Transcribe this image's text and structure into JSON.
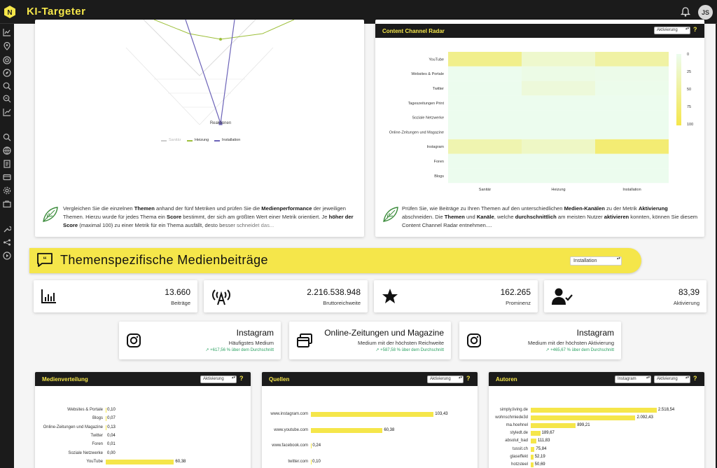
{
  "app": {
    "title": "KI-Targeter",
    "user_initials": "JS",
    "accent": "#f5e64a",
    "dark": "#1b1b1b"
  },
  "radar": {
    "axis_label": "Reaktionen",
    "legend": [
      "Sanitär",
      "Heizung",
      "Installation"
    ],
    "text_html": "Vergleichen Sie die einzelnen <b>Themen</b> anhand der fünf Metriken und prüfen Sie die <b>Medienperformance</b> der jeweiligen Themen. Hierzu wurde für jedes Thema ein <b>Score</b> bestimmt, der sich am größten Wert einer Metrik orientiert. Je <b>höher der Score</b> (maximal 100) zu einer Metrik für ein Thema ausfällt, desto besser schneidet das..."
  },
  "heatmap": {
    "title": "Content Channel Radar",
    "select": "Aktivierung",
    "help": "?",
    "rows": [
      "YouTube",
      "Websites & Portale",
      "Twitter",
      "Tageszeitungen Print",
      "Soziale Netzwerke",
      "Online-Zeitungen und Magazine",
      "Instagram",
      "Foren",
      "Blogs"
    ],
    "cols": [
      "Sanitär",
      "Heizung",
      "Installation"
    ],
    "values": [
      [
        60,
        20,
        45
      ],
      [
        0,
        5,
        3
      ],
      [
        0,
        12,
        2
      ],
      [
        0,
        0,
        0
      ],
      [
        0,
        0,
        0
      ],
      [
        0,
        0,
        0
      ],
      [
        38,
        25,
        75
      ],
      [
        0,
        0,
        0
      ],
      [
        0,
        0,
        0
      ]
    ],
    "scale": [
      "0",
      "25",
      "50",
      "75",
      "100"
    ],
    "text_html": "Prüfen Sie, wie Beiträge zu Ihren Themen auf den unterschiedlichen <b>Medien-Kanälen</b> zu der Metrik <b>Aktivierung</b> abschneiden. Die <b>Themen</b> und <b>Kanäle</b>, welche <b>durchschnittlich</b> am meisten Nutzer <b>aktivieren</b> konnten, können Sie diesem Content Channel Radar entnehmen...."
  },
  "section": {
    "title": "Themenspezifische Medienbeiträge",
    "select": "Installation"
  },
  "kpis": [
    {
      "value": "13.660",
      "label": "Beiträge",
      "icon": "bar-chart-icon"
    },
    {
      "value": "2.216.538.948",
      "label": "Bruttoreichweite",
      "icon": "antenna-icon"
    },
    {
      "value": "162.265",
      "label": "Prominenz",
      "icon": "star-icon"
    },
    {
      "value": "83,39",
      "label": "Aktivierung",
      "icon": "user-check-icon"
    }
  ],
  "highlights": [
    {
      "title": "Instagram",
      "subtitle": "Häufigstes Medium",
      "change": "↗ +617,56 % über dem Durchschnitt",
      "icon": "instagram-icon"
    },
    {
      "title": "Online-Zeitungen und Magazine",
      "subtitle": "Medium mit der höchsten Reichweite",
      "change": "↗ +587,58 % über dem Durchschnitt",
      "icon": "windows-icon"
    },
    {
      "title": "Instagram",
      "subtitle": "Medium mit der höchsten Aktivierung",
      "change": "↗ +465,67 % über dem Durchschnitt",
      "icon": "instagram-icon"
    }
  ],
  "medien": {
    "title": "Medienverteilung",
    "select": "Aktivierung",
    "help": "?",
    "max": 62,
    "items": [
      {
        "label": "Websites & Portale",
        "value": 0.1,
        "text": "0,10"
      },
      {
        "label": "Blogs",
        "value": 0.07,
        "text": "0,07"
      },
      {
        "label": "Online-Zeitungen und Magazine",
        "value": 0.13,
        "text": "0,13"
      },
      {
        "label": "Twitter",
        "value": 0.04,
        "text": "0,04"
      },
      {
        "label": "Foren",
        "value": 0.01,
        "text": "0,01"
      },
      {
        "label": "Soziale Netzwerke",
        "value": 0.0,
        "text": "0,00"
      },
      {
        "label": "YouTube",
        "value": 60.38,
        "text": "60,38"
      }
    ]
  },
  "quellen": {
    "title": "Quellen",
    "select": "Aktivierung",
    "help": "?",
    "max": 118,
    "items": [
      {
        "label": "www.instagram.com",
        "value": 103.43,
        "text": "103,43"
      },
      {
        "label": "www.youtube.com",
        "value": 60.38,
        "text": "60,38"
      },
      {
        "label": "www.facebook.com",
        "value": 0.24,
        "text": "0,24"
      },
      {
        "label": "twitter.com",
        "value": 0.1,
        "text": "0,10"
      }
    ]
  },
  "autoren": {
    "title": "Autoren",
    "select1": "Instagram",
    "select2": "Aktivierung",
    "help": "?",
    "max": 2800,
    "items": [
      {
        "label": "simply.living.de",
        "value": 2518.54,
        "text": "2.518,54"
      },
      {
        "label": "wohnschmiede3d",
        "value": 2092.43,
        "text": "2.092,43"
      },
      {
        "label": "ma.hoehnel",
        "value": 899.21,
        "text": "899,21"
      },
      {
        "label": "styledt.de",
        "value": 189.67,
        "text": "189,67"
      },
      {
        "label": "absolut_bad",
        "value": 111.83,
        "text": "111,83"
      },
      {
        "label": "tussit.ch",
        "value": 75.84,
        "text": "75,84"
      },
      {
        "label": "glaseffekt",
        "value": 52.19,
        "text": "52,19"
      },
      {
        "label": "hotzsteel",
        "value": 50.69,
        "text": "50,69"
      }
    ]
  }
}
